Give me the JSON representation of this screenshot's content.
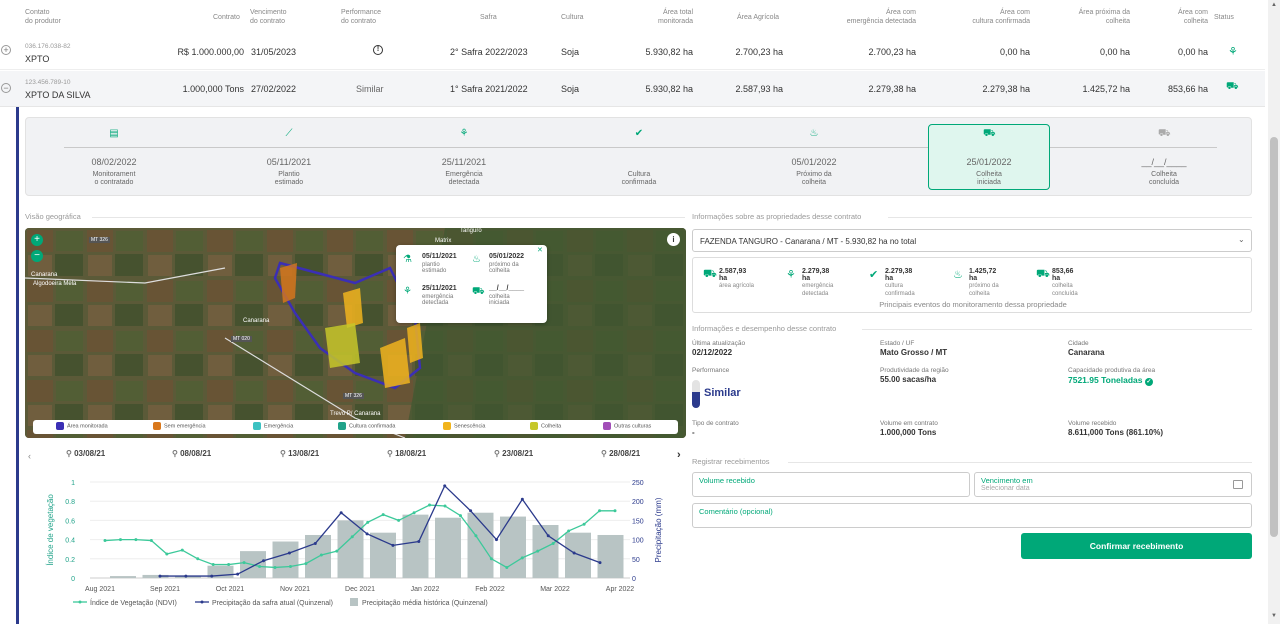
{
  "columns": [
    "Contato\ndo produtor",
    "Contrato",
    "Vencimento\ndo contrato",
    "Performance\ndo contrato",
    "Safra",
    "Cultura",
    "Área total\nmonitorada",
    "Área Agrícola",
    "Área com\nemergência detectada",
    "Área com\ncultura confirmada",
    "Área próxima da\ncolheita",
    "Área com\ncolheita",
    "Status"
  ],
  "rows": [
    {
      "doc": "036.176.038-82",
      "name": "XPTO",
      "contrato": "R$ 1.000.000,00",
      "venc": "31/05/2023",
      "perf": "",
      "safra": "2° Safra 2022/2023",
      "cultura": "Soja",
      "total": "5.930,82 ha",
      "agricola": "2.700,23 ha",
      "emerg": "2.700,23 ha",
      "conf": "0,00 ha",
      "prox": "0,00 ha",
      "colh": "0,00 ha"
    },
    {
      "doc": "123.456.789-10",
      "name": "XPTO DA SILVA",
      "contrato": "1.000,000 Tons",
      "venc": "27/02/2022",
      "perf": "Similar",
      "safra": "1° Safra 2021/2022",
      "cultura": "Soja",
      "total": "5.930,82 ha",
      "agricola": "2.587,93 ha",
      "emerg": "2.279,38 ha",
      "conf": "2.279,38 ha",
      "prox": "1.425,72 ha",
      "colh": "853,66 ha"
    }
  ],
  "timeline": [
    {
      "date": "08/02/2022",
      "label": "Monitorament\no contratado",
      "icon": "document-icon"
    },
    {
      "date": "05/11/2021",
      "label": "Plantio\nestimado",
      "icon": "seed-icon"
    },
    {
      "date": "25/11/2021",
      "label": "Emergência\ndetectada",
      "icon": "sprout-icon"
    },
    {
      "date": "",
      "label": "Cultura\nconfirmada",
      "icon": "check-circle-icon"
    },
    {
      "date": "05/01/2022",
      "label": "Próximo da\ncolheita",
      "icon": "plant-icon"
    },
    {
      "date": "25/01/2022",
      "label": "Colheita\niniciada",
      "icon": "tractor-icon"
    },
    {
      "date": "__/__/____",
      "label": "Colheita\nconcluída",
      "icon": "truck-icon"
    }
  ],
  "geo": {
    "title": "Visão geográfica",
    "map_labels": [
      "Tanguro",
      "Matrix",
      "Canarana",
      "Algodoeira Mela",
      "Canarana",
      "Trevo P/ Canarana",
      "MT 326",
      "MT 020",
      "MT 326"
    ],
    "popup": [
      {
        "date": "05/11/2021",
        "label": "plantio\nestimado"
      },
      {
        "date": "05/01/2022",
        "label": "próximo da\ncolheita"
      },
      {
        "date": "25/11/2021",
        "label": "emergência\ndetectada"
      },
      {
        "date": "__/__/____",
        "label": "colheita\niniciada"
      }
    ],
    "popup_close": "✕",
    "zoom_in": "+",
    "zoom_out": "−",
    "info": "i",
    "legend": [
      {
        "name": "Área monitorada",
        "color": "#3b2fb5"
      },
      {
        "name": "Sem emergência",
        "color": "#d9781c"
      },
      {
        "name": "Emergência",
        "color": "#3cc2c2"
      },
      {
        "name": "Cultura confirmada",
        "color": "#21a38a"
      },
      {
        "name": "Senescência",
        "color": "#f1b41d"
      },
      {
        "name": "Colheita",
        "color": "#c6c72a"
      },
      {
        "name": "Outras culturas",
        "color": "#a24fb8"
      }
    ],
    "dates": [
      "03/08/21",
      "08/08/21",
      "13/08/21",
      "18/08/21",
      "23/08/21",
      "28/08/21"
    ]
  },
  "chart_data": {
    "type": "bar",
    "categories": [
      "Aug 2021",
      "Sep 2021",
      "Oct 2021",
      "Nov 2021",
      "Dec 2021",
      "Jan 2022",
      "Feb 2022",
      "Mar 2022",
      "Apr 2022"
    ],
    "ylabel": "Índice de vegetação",
    "y2label": "Precipitação (mm)",
    "ylim": [
      0,
      1
    ],
    "y2lim": [
      0,
      250
    ],
    "yticks": [
      "0",
      "0.2",
      "0.4",
      "0.6",
      "0.8",
      "1"
    ],
    "y2ticks": [
      "0",
      "50",
      "100",
      "150",
      "200",
      "250"
    ],
    "series": [
      {
        "name": "Precipitação média histórica (Quinzenal)",
        "type": "bar",
        "values": [
          5,
          8,
          5,
          32,
          70,
          95,
          112,
          150,
          118,
          165,
          157,
          170,
          160,
          138,
          118,
          112
        ]
      },
      {
        "name": "Índice de Vegetação (NDVI)",
        "type": "line",
        "values": [
          0.39,
          0.4,
          0.4,
          0.39,
          0.25,
          0.29,
          0.2,
          0.14,
          0.14,
          0.16,
          0.12,
          0.11,
          0.12,
          0.15,
          0.24,
          0.28,
          0.43,
          0.58,
          0.66,
          0.6,
          0.68,
          0.76,
          0.75,
          0.65,
          0.44,
          0.2,
          0.11,
          0.21,
          0.28,
          0.36,
          0.49,
          0.56,
          0.7,
          0.7
        ]
      },
      {
        "name": "Precipitação da safra atual (Quinzenal)",
        "type": "line",
        "values": [
          5,
          5,
          5,
          10,
          45,
          65,
          90,
          170,
          115,
          85,
          95,
          240,
          175,
          100,
          205,
          110,
          65,
          40
        ]
      }
    ]
  },
  "info": {
    "title": "Informações sobre as propriedades desse contrato",
    "select": "FAZENDA TANGURO - Canarana / MT - 5.930,82 ha no total",
    "summary": [
      {
        "v": "2.587,93 ha",
        "l": "área agrícola",
        "icon": "tractor-icon"
      },
      {
        "v": "2.279,38 ha",
        "l": "emergência\ndetectada",
        "icon": "sprout-icon"
      },
      {
        "v": "2.279,38 ha",
        "l": "cultura\nconfirmada",
        "icon": "check-circle-icon"
      },
      {
        "v": "1.425,72 ha",
        "l": "próximo da\ncolheita",
        "icon": "plant-icon"
      },
      {
        "v": "853,66 ha",
        "l": "colheita\nconcluída",
        "icon": "truck-icon"
      }
    ],
    "summary_note": "Principais eventos do monitoramento dessa propriedade"
  },
  "perf": {
    "title": "Informações e desempenho desse contrato",
    "ultima_l": "Última atualização",
    "ultima_v": "02/12/2022",
    "estado_l": "Estado / UF",
    "estado_v": "Mato Grosso / MT",
    "cidade_l": "Cidade",
    "cidade_v": "Canarana",
    "perf_l": "Performance",
    "perf_v": "Similar",
    "prod_l": "Produtividade da região",
    "prod_v": "55.00 sacas/ha",
    "cap_l": "Capacidade produtiva da área",
    "cap_v": "7521.95 Toneladas",
    "tipo_l": "Tipo de contrato",
    "tipo_v": "-",
    "vol_l": "Volume em contrato",
    "vol_v": "1.000,000 Tons",
    "rec_l": "Volume recebido",
    "rec_v": "8.611,000 Tons (861.10%)"
  },
  "receb": {
    "title": "Registrar recebimentos",
    "volume": "Volume recebido",
    "venc": "Vencimento em",
    "venc_ph": "Selecionar data",
    "coment": "Comentário (opcional)",
    "btn": "Confirmar recebimento"
  },
  "colors": {
    "accent": "#00a878",
    "navy": "#2b3a8c"
  }
}
